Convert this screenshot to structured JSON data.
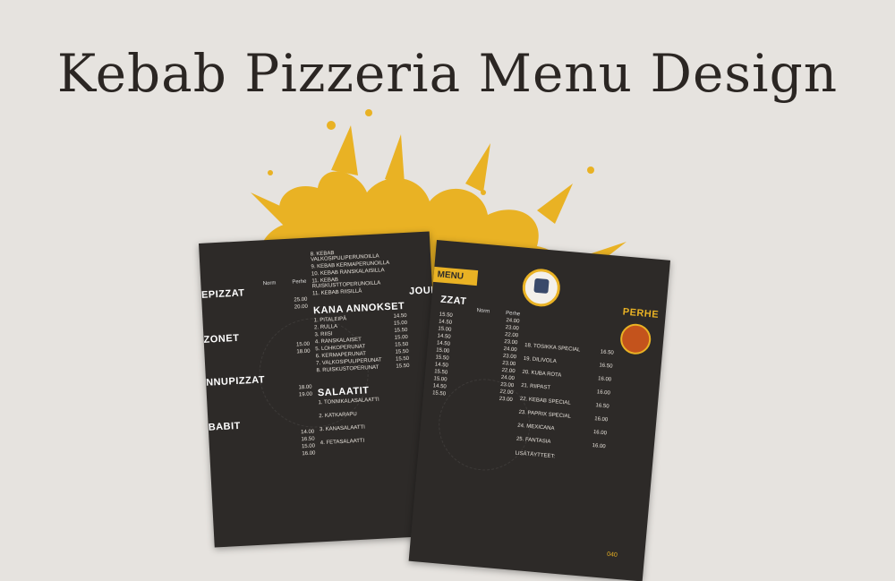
{
  "title": "Kebab Pizzeria Menu Design",
  "colors": {
    "background": "#e6e3df",
    "accent": "#e9b224",
    "paper": "#2d2a28",
    "text": "#2b2623"
  },
  "left_sheet": {
    "columns": [
      "Norm",
      "Perhe"
    ],
    "sections": [
      {
        "name": "EPIZZAT",
        "items": [
          [
            "",
            "25.00"
          ],
          [
            "",
            "20.00"
          ]
        ]
      },
      {
        "name": "ZONET",
        "items": [
          [
            "",
            "15.00"
          ],
          [
            "",
            "18.00"
          ]
        ]
      },
      {
        "name": "NNUPIZZAT",
        "items": [
          [
            "",
            "18.00"
          ],
          [
            "",
            "19.00"
          ]
        ]
      },
      {
        "name": "BABIT",
        "items": [
          [
            "",
            "14.00"
          ],
          [
            "",
            "16.50"
          ],
          [
            "",
            "15.00"
          ],
          [
            "",
            "16.00"
          ]
        ]
      }
    ],
    "kebab_lines": [
      "8. KEBAB VALKOSIPULIPERUNOILLA",
      "9. KEBAB KERMAPERUNOILLA",
      "10. KEBAB RANSKALAISILLA",
      "11. KEBAB RUISKUSTTOPERUNOILLA",
      "11. KEBAB RIISILLÄ"
    ],
    "kana_title": "KANA ANNOKSET",
    "kana_items": [
      [
        "1. PITALEIPÄ",
        "14.50"
      ],
      [
        "2. RULLA",
        "15.00"
      ],
      [
        "3. RIISI",
        "15.50"
      ],
      [
        "4. RANSKALAISET",
        "15.00"
      ],
      [
        "5. LOHKOPERUNAT",
        "15.50"
      ],
      [
        "6. KERMAPERUNAT",
        "15.50"
      ],
      [
        "7. VALKOSIPULIPERUNAT",
        "15.50"
      ],
      [
        "8. RUISKUSTOPERUNAT",
        "15.50"
      ]
    ],
    "salaatit_title": "SALAATIT",
    "salaatit_items": [
      "1. TONNIKALASALAATTI",
      "2. KATKARAPU",
      "3. KANASALAATTI",
      "4. FETASALAATTI"
    ],
    "jouma_title": "JOUM"
  },
  "right_sheet": {
    "ribbon": "MENU",
    "section": "ZZAT",
    "columns": [
      "Norm",
      "Perhe"
    ],
    "items": [
      [
        "15.50",
        "24.00"
      ],
      [
        "14.50",
        "23.00"
      ],
      [
        "15.00",
        "22.00"
      ],
      [
        "14.50",
        "23.00"
      ],
      [
        "14.50",
        "24.00"
      ],
      [
        "15.00",
        "23.00"
      ],
      [
        "15.50",
        "23.00"
      ],
      [
        "14.50",
        "22.00"
      ],
      [
        "15.50",
        "24.00"
      ],
      [
        "15.00",
        "23.00"
      ],
      [
        "14.50",
        "22.00"
      ],
      [
        "15.50",
        "23.00"
      ]
    ],
    "specials": [
      [
        "18. TOSIKKA SPECIAL",
        "16.50"
      ],
      [
        "19. DILIVOLA",
        "16.50"
      ],
      [
        "20. KUBA ROTA",
        "16.00"
      ],
      [
        "21. RIIPAST",
        "16.00"
      ],
      [
        "22. KEBAB SPECIAL",
        "16.50"
      ],
      [
        "23. PAPRIX SPECIAL",
        "16.00"
      ],
      [
        "24. MEXICANA",
        "16.00"
      ],
      [
        "25. FANTASIA",
        "16.00"
      ]
    ],
    "lisataytteet": "LISÄTÄYTTEET:",
    "perhe_label": "PERHE",
    "phone_label": "040"
  }
}
